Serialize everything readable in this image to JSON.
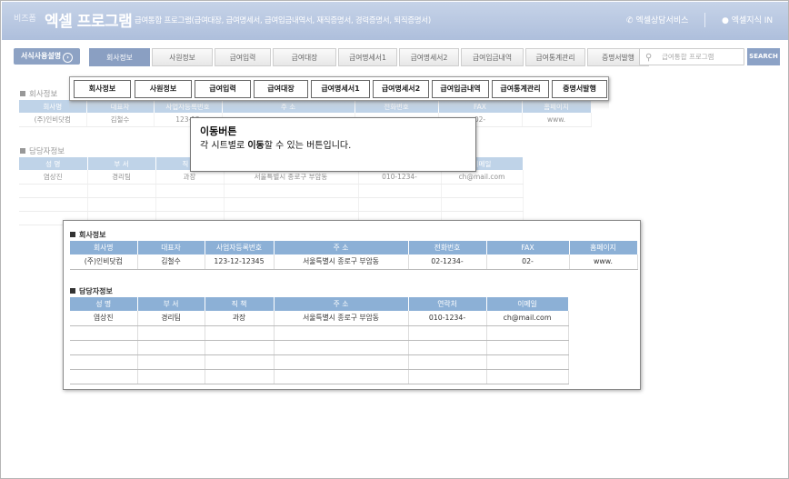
{
  "header": {
    "brand": "비즈폼",
    "app_title": "엑셀 프로그램",
    "subtitle": "급여통합 프로그램(급여대장, 급여명세서, 급여입금내역서, 재직증명서, 경력증명서, 퇴직증명서)",
    "consult": "엑셀상담서비스",
    "knowledge": "엑셀지식 IN"
  },
  "nav": {
    "usage_label": "서식사용설명",
    "tabs": [
      "회사정보",
      "사원정보",
      "급여입력",
      "급여대장",
      "급여명세서1",
      "급여명세서2",
      "급여입금내역",
      "급여통계관리",
      "증명서발행"
    ],
    "active_index": 0,
    "search_placeholder": "급여통합 프로그램",
    "search_button": "SEARCH"
  },
  "highlight_tabs": [
    "회사정보",
    "사원정보",
    "급여입력",
    "급여대장",
    "급여명세서1",
    "급여명세서2",
    "급여입금내역",
    "급여통계관리",
    "증명서발행"
  ],
  "tooltip": {
    "title": "이동버튼",
    "desc_pre": "각 시트별로 ",
    "desc_bold": "이동",
    "desc_post": "할 수 있는 버튼입니다."
  },
  "company": {
    "title": "회사정보",
    "headers": [
      "회사명",
      "대표자",
      "사업자등록번호",
      "주 소",
      "전화번호",
      "FAX",
      "홈페이지"
    ],
    "row": [
      "(주)인비닷컴",
      "김철수",
      "123-12-12345",
      "서울특별시 종로구 부암동",
      "02-1234-",
      "02-",
      "www."
    ]
  },
  "contact": {
    "title": "담당자정보",
    "headers": [
      "성 명",
      "부 서",
      "직 책",
      "주 소",
      "연락처",
      "이메일"
    ],
    "row": [
      "염상진",
      "경리팀",
      "과장",
      "서울특별시 종로구 부암동",
      "010-1234-",
      "ch@mail.com"
    ]
  },
  "bg_company": {
    "row": [
      "(주)인비닷컴",
      "김철수",
      "123-12",
      "",
      "",
      "02-",
      "www."
    ]
  },
  "bg_contact": {
    "row": [
      "염상진",
      "경리팀",
      "과장",
      "서울특별시 종로구 부암동",
      "010-1234-",
      "ch@mail.com"
    ]
  }
}
